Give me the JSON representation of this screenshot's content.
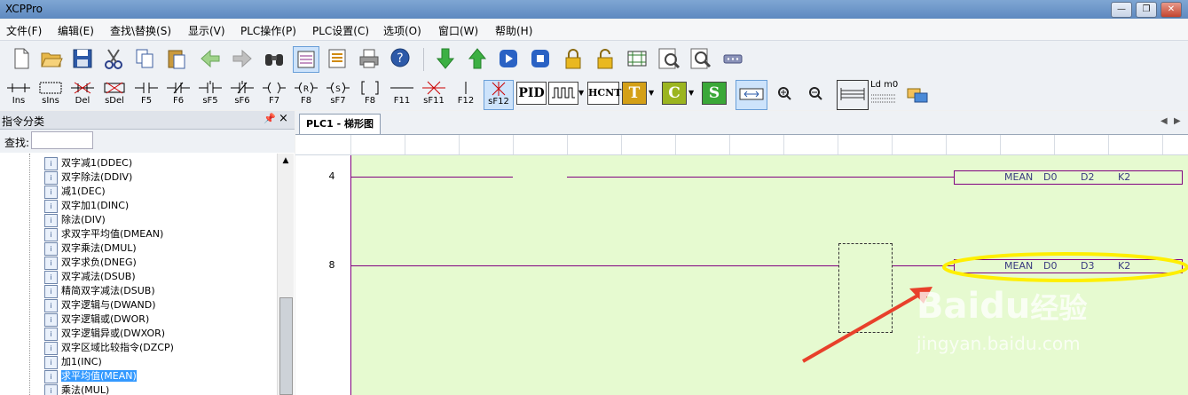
{
  "window": {
    "title": "XCPPro"
  },
  "menu": [
    "文件(F)",
    "编辑(E)",
    "查找\\替换(S)",
    "显示(V)",
    "PLC操作(P)",
    "PLC设置(C)",
    "选项(O)",
    "窗口(W)",
    "帮助(H)"
  ],
  "toolbar1_icons": [
    "new-file-icon",
    "open-folder-icon",
    "save-icon",
    "cut-icon",
    "copy-icon",
    "paste-icon",
    "back-arrow-icon",
    "forward-arrow-icon",
    "find-binoculars-icon",
    "ladder-view-icon",
    "instruction-list-icon",
    "print-icon",
    "help-icon",
    "download-icon",
    "upload-icon",
    "run-icon",
    "stop-icon",
    "lock-icon",
    "unlock-icon",
    "monitor-icon",
    "zoom-page-icon",
    "zoom-doc-icon",
    "comm-port-icon"
  ],
  "toolbar2": {
    "labels": [
      "Ins",
      "sIns",
      "Del",
      "sDel",
      "F5",
      "F6",
      "sF5",
      "sF6",
      "F7",
      "F8",
      "sF7",
      "F8",
      "F11",
      "sF11",
      "F12",
      "sF12"
    ],
    "pid": "PID",
    "hcnt": "HCNT",
    "t": "T",
    "c": "C",
    "s": "S",
    "ld_label": "Ld m0",
    "colors": {
      "t": "#d4a017",
      "c": "#9bb520",
      "s": "#3aa838"
    }
  },
  "left_pane": {
    "title": "指令分类",
    "pin": "ꟷ",
    "close": "×",
    "search_label": "查找:",
    "search_value": "",
    "items": [
      "双字减1(DDEC)",
      "双字除法(DDIV)",
      "减1(DEC)",
      "双字加1(DINC)",
      "除法(DIV)",
      "求双字平均值(DMEAN)",
      "双字乘法(DMUL)",
      "双字求负(DNEG)",
      "双字减法(DSUB)",
      "精简双字减法(DSUB)",
      "双字逻辑与(DWAND)",
      "双字逻辑或(DWOR)",
      "双字逻辑异或(DWXOR)",
      "双字区域比较指令(DZCP)",
      "加1(INC)",
      "求平均值(MEAN)",
      "乘法(MUL)"
    ],
    "selected_index": 15
  },
  "editor": {
    "tab_label": "PLC1 - 梯形图",
    "rungs": [
      {
        "number": "4",
        "instr": "MEAN",
        "op1": "D0",
        "op2": "D2",
        "op3": "K2"
      },
      {
        "number": "8",
        "instr": "MEAN",
        "op1": "D0",
        "op2": "D3",
        "op3": "K2"
      }
    ],
    "rail_color": "#800080",
    "bg_color": "#e6fad0"
  },
  "watermark": {
    "brand": "Baidu",
    "suffix": "经验",
    "url": "jingyan.baidu.com"
  },
  "annotation_colors": {
    "ellipse": "#ffef00",
    "arrow": "#e8402b"
  }
}
